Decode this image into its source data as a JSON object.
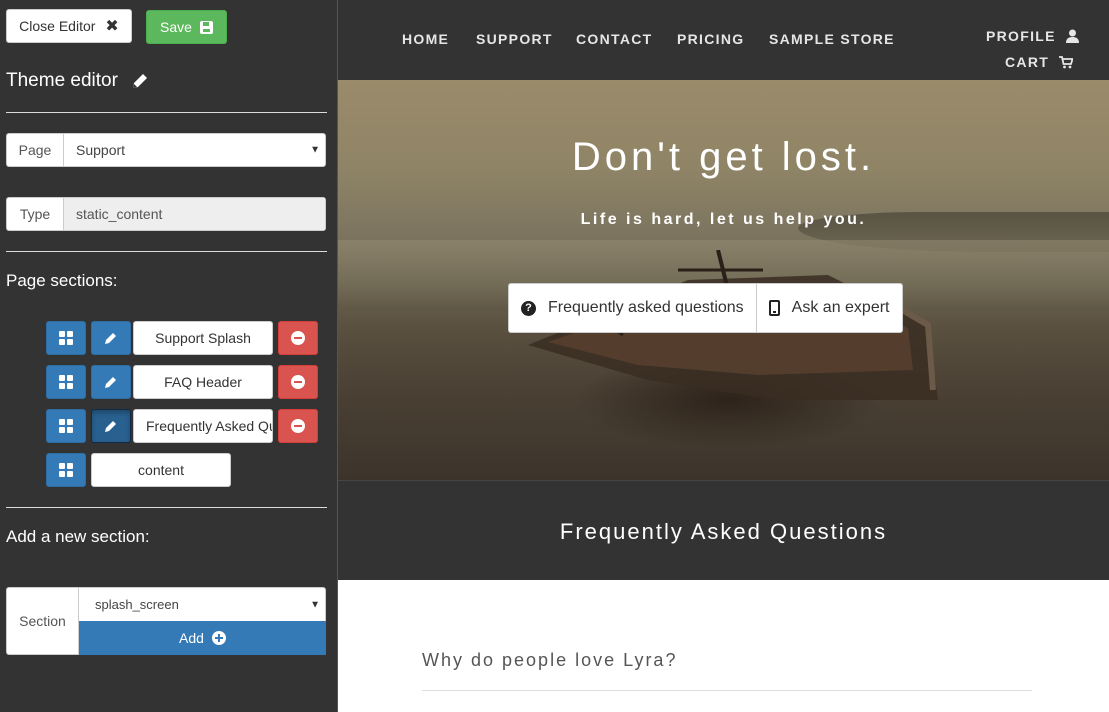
{
  "editor": {
    "close_label": "Close Editor",
    "save_label": "Save",
    "title": "Theme editor",
    "page_field": {
      "label": "Page",
      "value": "Support"
    },
    "type_field": {
      "label": "Type",
      "value": "static_content"
    },
    "sections_heading": "Page sections:",
    "sections": [
      {
        "name": "Support Splash"
      },
      {
        "name": "FAQ Header"
      },
      {
        "name": "Frequently Asked Qu"
      },
      {
        "name": "content"
      }
    ],
    "add_heading": "Add a new section:",
    "add_form": {
      "label": "Section",
      "value": "splash_screen",
      "button": "Add"
    }
  },
  "site": {
    "nav": {
      "items": [
        "HOME",
        "SUPPORT",
        "CONTACT",
        "PRICING",
        "SAMPLE STORE"
      ],
      "profile": "PROFILE",
      "cart": "CART"
    },
    "hero": {
      "title": "Don't get lost.",
      "subtitle": "Life is hard, let us help you.",
      "buttons": [
        "Frequently asked questions",
        "Ask an expert"
      ]
    },
    "faq": {
      "title": "Frequently Asked Questions",
      "question": "Why do people love Lyra?"
    }
  },
  "colors": {
    "dark_bg": "#333333",
    "primary": "#337ab7",
    "success": "#5cb85c",
    "danger": "#d9534f"
  }
}
